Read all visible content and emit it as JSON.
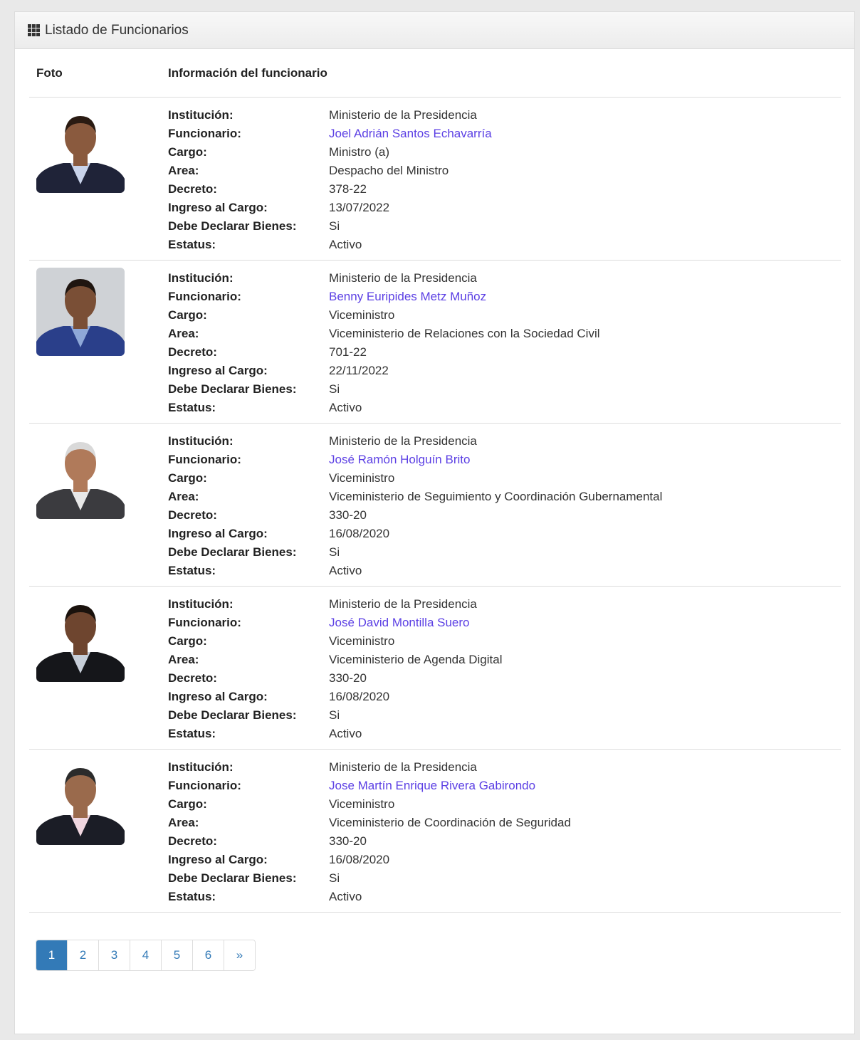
{
  "panel": {
    "title": "Listado de Funcionarios"
  },
  "table": {
    "headers": {
      "photo": "Foto",
      "info": "Información del funcionario"
    },
    "labels": {
      "institucion": "Institución:",
      "funcionario": "Funcionario:",
      "cargo": "Cargo:",
      "area": "Area:",
      "decreto": "Decreto:",
      "ingreso": "Ingreso al Cargo:",
      "declarar": "Debe Declarar Bienes:",
      "estatus": "Estatus:"
    },
    "rows": [
      {
        "institucion": "Ministerio de la Presidencia",
        "funcionario": "Joel Adrián Santos Echavarría",
        "cargo": "Ministro (a)",
        "area": "Despacho del Ministro",
        "decreto": "378-22",
        "ingreso": "13/07/2022",
        "declarar": "Si",
        "estatus": "Activo"
      },
      {
        "institucion": "Ministerio de la Presidencia",
        "funcionario": "Benny Euripides Metz Muñoz",
        "cargo": "Viceministro",
        "area": "Viceministerio de Relaciones con la Sociedad Civil",
        "decreto": "701-22",
        "ingreso": "22/11/2022",
        "declarar": "Si",
        "estatus": "Activo"
      },
      {
        "institucion": "Ministerio de la Presidencia",
        "funcionario": "José Ramón Holguín Brito",
        "cargo": "Viceministro",
        "area": "Viceministerio de Seguimiento y Coordinación Gubernamental",
        "decreto": "330-20",
        "ingreso": "16/08/2020",
        "declarar": "Si",
        "estatus": "Activo"
      },
      {
        "institucion": "Ministerio de la Presidencia",
        "funcionario": "José David Montilla Suero",
        "cargo": "Viceministro",
        "area": "Viceministerio de Agenda Digital",
        "decreto": "330-20",
        "ingreso": "16/08/2020",
        "declarar": "Si",
        "estatus": "Activo"
      },
      {
        "institucion": "Ministerio de la Presidencia",
        "funcionario": "Jose Martín Enrique Rivera Gabirondo",
        "cargo": "Viceministro",
        "area": "Viceministerio de Coordinación de Seguridad",
        "decreto": "330-20",
        "ingreso": "16/08/2020",
        "declarar": "Si",
        "estatus": "Activo"
      }
    ]
  },
  "pagination": {
    "pages": [
      "1",
      "2",
      "3",
      "4",
      "5",
      "6",
      "»"
    ],
    "active": "1"
  },
  "colors": {
    "link": "#5b3fe4",
    "active_page": "#337ab7"
  }
}
